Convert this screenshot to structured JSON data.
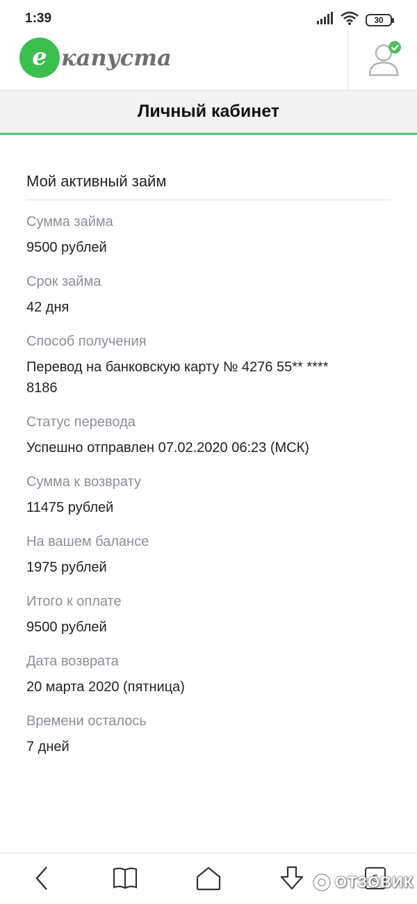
{
  "status_bar": {
    "time": "1:39",
    "battery": "30"
  },
  "header": {
    "logo_letter": "e",
    "logo_text": "капуста"
  },
  "page": {
    "title": "Личный кабинет"
  },
  "loan": {
    "section_title": "Мой активный займ",
    "fields": [
      {
        "label": "Сумма займа",
        "value": "9500 рублей"
      },
      {
        "label": "Срок займа",
        "value": "42 дня"
      },
      {
        "label": "Способ получения",
        "value": "Перевод на банковскую карту № 4276 55** ****\n8186"
      },
      {
        "label": "Статус перевода",
        "value": "Успешно отправлен 07.02.2020 06:23 (МСК)"
      },
      {
        "label": "Сумма к возврату",
        "value": "11475 рублей"
      },
      {
        "label": "На вашем балансе",
        "value": "1975 рублей"
      },
      {
        "label": "Итого к оплате",
        "value": "9500 рублей"
      },
      {
        "label": "Дата возврата",
        "value": "20 марта 2020 (пятница)"
      },
      {
        "label": "Времени осталось",
        "value": "7 дней"
      }
    ]
  },
  "bottom_nav": {
    "tabs_count": "5",
    "icons": [
      "back-icon",
      "bookmarks-icon",
      "home-icon",
      "download-icon",
      "tabs-icon"
    ]
  },
  "watermark": {
    "text": "ОТЗОВИК"
  },
  "colors": {
    "brand_green": "#3bbf4f",
    "title_underline": "#5bbf6e",
    "label_gray": "#8b8f96"
  }
}
